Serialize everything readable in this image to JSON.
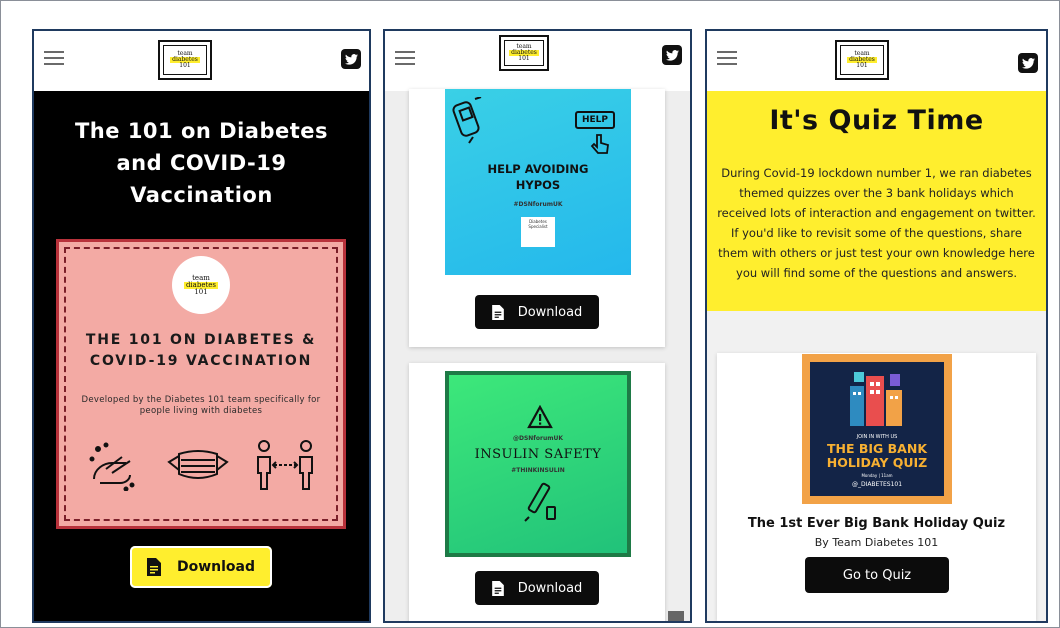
{
  "brand": {
    "logo_top": "team",
    "logo_mid": "diabetes",
    "logo_bot": "101"
  },
  "panel1": {
    "hero_title": "The 101 on Diabetes and COVID-19 Vaccination",
    "poster": {
      "badge_top": "team",
      "badge_mid": "diabetes",
      "badge_bot": "101",
      "title": "THE 101 ON DIABETES & COVID-19 VACCINATION",
      "subtitle": "Developed by the Diabetes 101 team specifically for people living with diabetes"
    },
    "download_label": "Download"
  },
  "panel2": {
    "card1": {
      "help_label": "HELP",
      "title_line1": "HELP AVOIDING",
      "title_line2": "HYPOS",
      "tag": "#DSNforumUK",
      "badge": "Diabetes Specialist",
      "download_label": "Download"
    },
    "card2": {
      "tag_top": "@DSNforumUK",
      "title": "INSULIN SAFETY",
      "tag_bottom": "#THINKINSULIN",
      "download_label": "Download"
    }
  },
  "panel3": {
    "quiz_title": "It's Quiz Time",
    "quiz_text": "During Covid-19 lockdown number 1, we ran diabetes themed quizzes over the 3 bank holidays which received lots of interaction and engagement on twitter. If you'd like to revisit some of the questions, share them with others or just test your own knowledge here you will find some of the questions and answers.",
    "poster": {
      "join": "JOIN IN WITH US",
      "title": "THE BIG BANK HOLIDAY QUIZ",
      "sub": "Monday | 11am",
      "handle": "@_DIABETES101"
    },
    "quiz_name": "The 1st Ever Big Bank Holiday Quiz",
    "quiz_by": "By Team Diabetes 101",
    "button_label": "Go to Quiz"
  },
  "colors": {
    "accent_yellow": "#ffee2e",
    "poster_pink": "#f3aaa4",
    "frame_navy": "#1f3a5f",
    "button_black": "#0c0c0c"
  }
}
